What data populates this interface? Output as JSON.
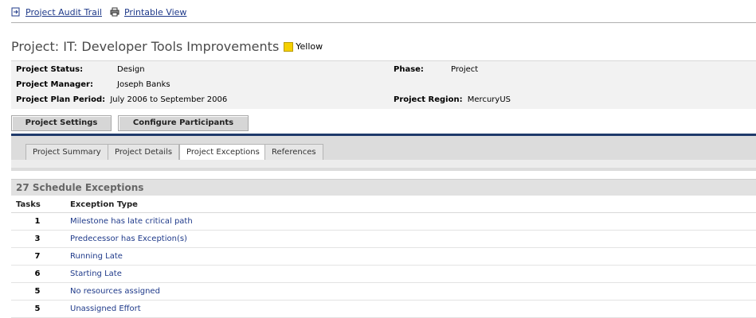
{
  "top_links": {
    "audit_trail": "Project Audit Trail",
    "printable_view": "Printable View"
  },
  "project": {
    "title": "Project: IT: Developer Tools Improvements",
    "health_label": "Yellow",
    "health_color": "#f5d000"
  },
  "info": {
    "status_label": "Project Status:",
    "status_value": "Design",
    "manager_label": "Project Manager:",
    "manager_value": "Joseph Banks",
    "plan_period_label": "Project Plan Period:",
    "plan_period_value": "July 2006 to September 2006",
    "phase_label": "Phase:",
    "phase_value": "Project",
    "region_label": "Project Region:",
    "region_value": "MercuryUS"
  },
  "buttons": {
    "settings": "Project Settings",
    "participants": "Configure Participants"
  },
  "tabs": [
    {
      "label": "Project Summary"
    },
    {
      "label": "Project Details"
    },
    {
      "label": "Project Exceptions"
    },
    {
      "label": "References"
    }
  ],
  "exceptions": {
    "header": "27 Schedule Exceptions",
    "col_tasks": "Tasks",
    "col_type": "Exception Type",
    "rows": [
      {
        "count": "1",
        "type": "Milestone has late critical path"
      },
      {
        "count": "3",
        "type": "Predecessor has Exception(s)"
      },
      {
        "count": "7",
        "type": "Running Late"
      },
      {
        "count": "6",
        "type": "Starting Late"
      },
      {
        "count": "5",
        "type": "No resources assigned"
      },
      {
        "count": "5",
        "type": "Unassigned Effort"
      }
    ]
  }
}
